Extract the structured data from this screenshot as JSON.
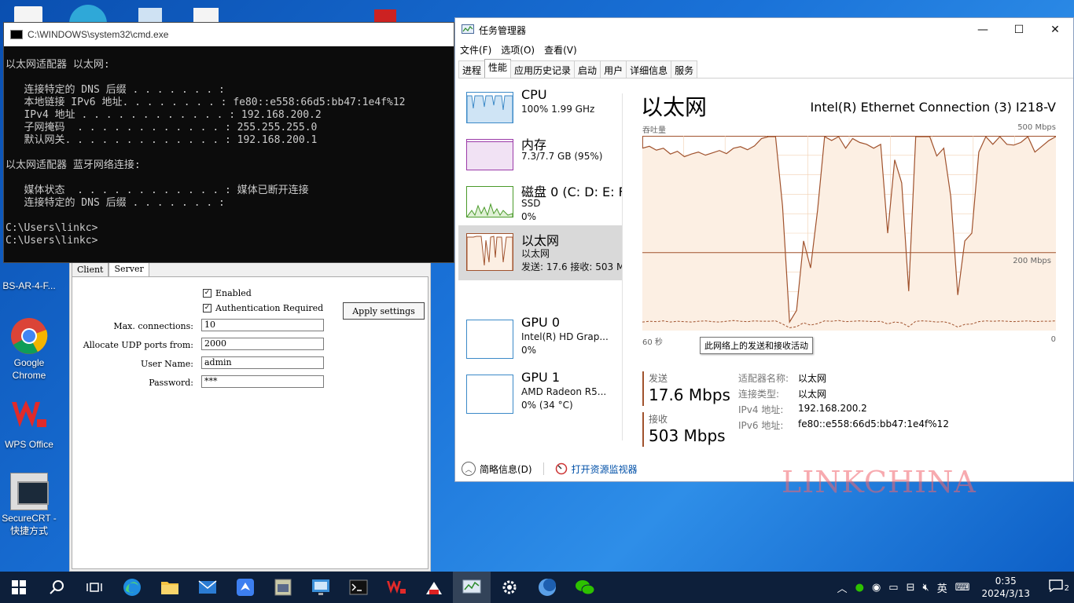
{
  "desktop": {
    "icons": [
      {
        "label": "BS-AR-4-F..."
      },
      {
        "label": "Google Chrome"
      },
      {
        "label": "WPS Office"
      },
      {
        "label": "SecureCRT - 快捷方式"
      }
    ]
  },
  "proxy": {
    "tabs": [
      "Client",
      "Server"
    ],
    "enabled_label": "Enabled",
    "auth_label": "Authentication Required",
    "apply_label": "Apply settings",
    "fields": [
      {
        "label": "Max. connections:",
        "value": "10"
      },
      {
        "label": "Allocate UDP ports from:",
        "value": "2000"
      },
      {
        "label": "User Name:",
        "value": "admin"
      },
      {
        "label": "Password:",
        "value": "***"
      }
    ]
  },
  "cmd": {
    "title": "C:\\WINDOWS\\system32\\cmd.exe",
    "lines": [
      "",
      "以太网适配器 以太网:",
      "",
      "   连接特定的 DNS 后缀 . . . . . . . :",
      "   本地链接 IPv6 地址. . . . . . . . : fe80::e558:66d5:bb47:1e4f%12",
      "   IPv4 地址 . . . . . . . . . . . . : 192.168.200.2",
      "   子网掩码  . . . . . . . . . . . . : 255.255.255.0",
      "   默认网关. . . . . . . . . . . . . : 192.168.200.1",
      "",
      "以太网适配器 蓝牙网络连接:",
      "",
      "   媒体状态  . . . . . . . . . . . . : 媒体已断开连接",
      "   连接特定的 DNS 后缀 . . . . . . . :",
      "",
      "C:\\Users\\linkc>",
      "C:\\Users\\linkc>"
    ]
  },
  "taskmgr": {
    "title": "任务管理器",
    "menu": [
      "文件(F)",
      "选项(O)",
      "查看(V)"
    ],
    "tabs": [
      "进程",
      "性能",
      "应用历史记录",
      "启动",
      "用户",
      "详细信息",
      "服务"
    ],
    "active_tab": "性能",
    "side": [
      {
        "name": "CPU",
        "sub1": "100% 1.99 GHz",
        "sub2": ""
      },
      {
        "name": "内存",
        "sub1": "7.3/7.7 GB (95%)",
        "sub2": ""
      },
      {
        "name": "磁盘 0 (C: D: E: F:",
        "sub1": "SSD",
        "sub2": "0%"
      },
      {
        "name": "以太网",
        "sub1": "以太网",
        "sub2": "发送: 17.6 接收: 503 M"
      },
      {
        "name": "GPU 0",
        "sub1": "Intel(R) HD Grap...",
        "sub2": "0%"
      },
      {
        "name": "GPU 1",
        "sub1": "AMD Radeon R5...",
        "sub2": "0% (34 °C)"
      }
    ],
    "main": {
      "title": "以太网",
      "device": "Intel(R) Ethernet Connection (3) I218-V",
      "throughput_label": "吞吐量",
      "max_label": "500 Mbps",
      "mid_label": "200 Mbps",
      "x_left": "60 秒",
      "x_right": "0",
      "tooltip": "此网络上的发送和接收活动",
      "send_label": "发送",
      "send_value": "17.6 Mbps",
      "recv_label": "接收",
      "recv_value": "503 Mbps",
      "info": [
        {
          "k": "适配器名称:",
          "v": "以太网"
        },
        {
          "k": "连接类型:",
          "v": "以太网"
        },
        {
          "k": "IPv4 地址:",
          "v": "192.168.200.2"
        },
        {
          "k": "IPv6 地址:",
          "v": "fe80::e558:66d5:bb47:1e4f%12"
        }
      ]
    },
    "footer": {
      "summary": "简略信息(D)",
      "monitor": "打开资源监视器"
    }
  },
  "chart_data": {
    "type": "line",
    "title": "",
    "xlabel": "",
    "ylabel": "吞吐量",
    "ylim": [
      0,
      500
    ],
    "x_range_seconds": [
      60,
      0
    ],
    "series": [
      {
        "name": "接收",
        "values": [
          470,
          475,
          465,
          470,
          455,
          462,
          448,
          455,
          460,
          452,
          458,
          464,
          456,
          470,
          474,
          466,
          476,
          495,
          500,
          500,
          320,
          20,
          50,
          230,
          160,
          310,
          500,
          490,
          500,
          470,
          495,
          485,
          480,
          470,
          480,
          250,
          440,
          380,
          100,
          500,
          500,
          500,
          450,
          470,
          345,
          90,
          230,
          250,
          460,
          500,
          480,
          500,
          480,
          478,
          485,
          500,
          460,
          475,
          490,
          500
        ]
      },
      {
        "name": "发送",
        "values": [
          20,
          22,
          21,
          23,
          20,
          22,
          21,
          20,
          22,
          23,
          21,
          20,
          22,
          24,
          22,
          21,
          23,
          22,
          22,
          23,
          15,
          5,
          8,
          18,
          12,
          16,
          23,
          22,
          24,
          21,
          22,
          23,
          22,
          21,
          22,
          15,
          20,
          18,
          8,
          22,
          23,
          22,
          20,
          21,
          16,
          7,
          14,
          15,
          21,
          23,
          22,
          23,
          22,
          21,
          22,
          23,
          21,
          22,
          22,
          23
        ]
      }
    ],
    "colors": {
      "line": "#a0522d",
      "fill": "#fcefe3",
      "grid": "#f2cfb0"
    }
  },
  "taskbar": {
    "time": "0:35",
    "date": "2024/3/13",
    "ime": "英",
    "notif_count": "2"
  }
}
